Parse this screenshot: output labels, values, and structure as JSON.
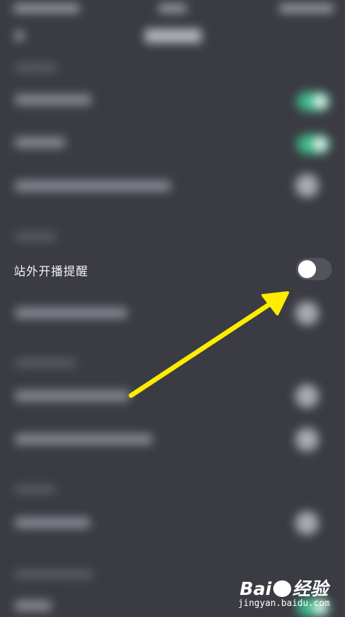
{
  "setting_row": {
    "label": "站外开播提醒",
    "toggle_on": false
  },
  "watermark": {
    "brand_left": "Bai",
    "brand_right": "经验",
    "url": "jingyan.baidu.com"
  },
  "colors": {
    "background": "#3b3c43",
    "toggle_on": "#3fb88a",
    "toggle_off": "#52535b",
    "arrow": "#ffec00"
  }
}
